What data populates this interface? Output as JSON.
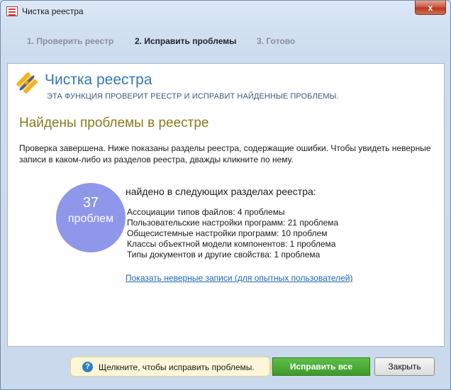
{
  "window": {
    "title": "Чистка реестра",
    "close_glyph": "x"
  },
  "steps": [
    {
      "label": "1. Проверить реестр",
      "active": false
    },
    {
      "label": "2. Исправить проблемы",
      "active": true
    },
    {
      "label": "3. Готово",
      "active": false
    }
  ],
  "header": {
    "title": "Чистка реестра",
    "subtitle": "ЭТА ФУНКЦИЯ ПРОВЕРИТ РЕЕСТР И ИСПРАВИТ НАЙДЕННЫЕ ПРОБЛЕМЫ."
  },
  "main": {
    "section_title": "Найдены проблемы в реестре",
    "description": "Проверка завершена. Ниже показаны разделы реестра, содержащие ошибки. Чтобы увидеть неверные записи в каком-либо из разделов реестра, дважды кликните по нему.",
    "count": {
      "number": "37",
      "label": "проблем"
    },
    "found_header": "найдено в следующих разделах реестра:",
    "found_items": [
      "Ассоциации типов файлов: 4 проблемы",
      "Пользовательские настройки программ: 21 проблема",
      "Общесистемные настройки программ: 10 проблем",
      "Классы объектной модели компонентов: 1 проблема",
      "Типы документов и другие свойства: 1 проблема"
    ],
    "details_link": "Показать неверные записи (для опытных пользователей)"
  },
  "footer": {
    "hint_icon": "?",
    "hint_text": "Щелкните, чтобы исправить проблемы.",
    "fix_all_label": "Исправить все",
    "close_label": "Закрыть"
  },
  "colors": {
    "accent": "#3478b8",
    "section_title": "#8a7a1e",
    "count_circle": "#8e97ea",
    "fix_button": "#4aa834",
    "link": "#1f66b4"
  }
}
